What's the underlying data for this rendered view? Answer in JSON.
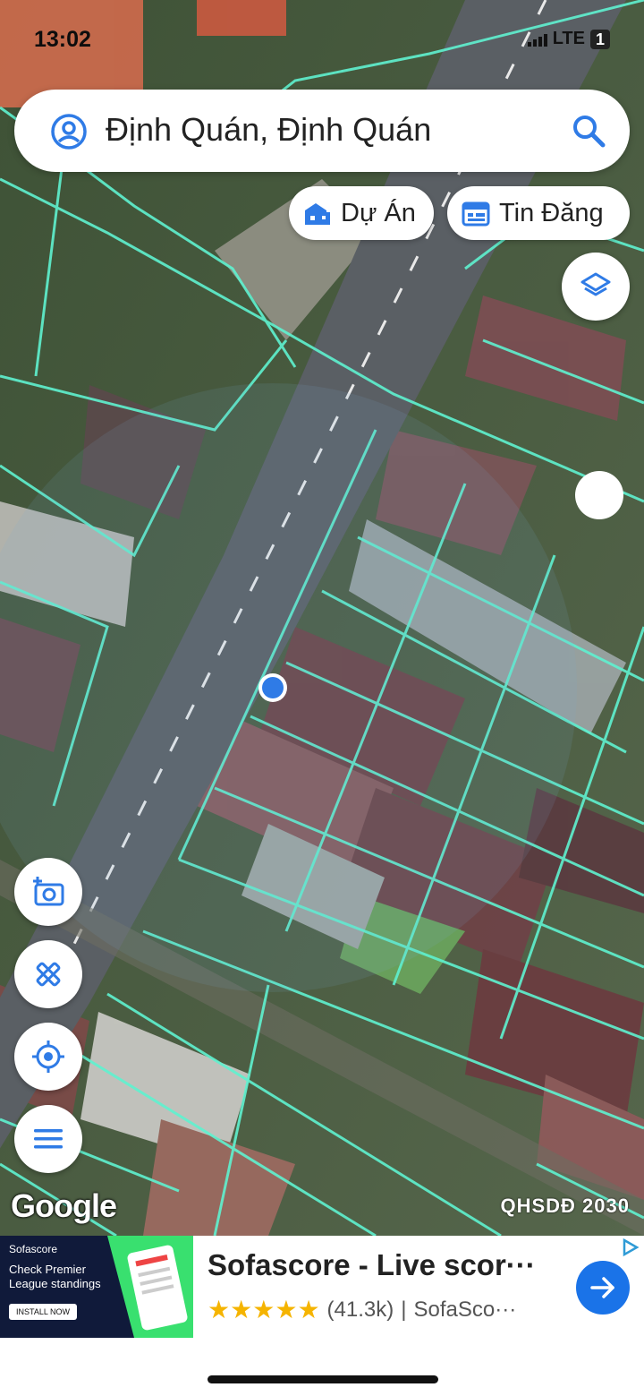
{
  "status_bar": {
    "time": "13:02",
    "network": "LTE",
    "battery": "1"
  },
  "search": {
    "location_text": "Định Quán, Định Quán"
  },
  "chips": {
    "projects_label": "Dự Án",
    "listings_label": "Tin Đăng"
  },
  "map": {
    "attribution": "Google",
    "layer_name": "QHSDĐ 2030",
    "colors": {
      "parcel_outline": "#5ff2d0",
      "location_dot": "#2f7be6",
      "road": "#5a5f64"
    }
  },
  "controls": {
    "icons": [
      "layers-icon",
      "camera-icon",
      "ruler-pencil-icon",
      "my-location-icon",
      "menu-icon"
    ]
  },
  "ad": {
    "thumb_brand": "Sofascore",
    "thumb_text": "Check Premier League standings",
    "thumb_button": "INSTALL NOW",
    "title": "Sofascore - Live scor···",
    "rating_count": "(41.3k)",
    "developer": "SofaSco···"
  }
}
